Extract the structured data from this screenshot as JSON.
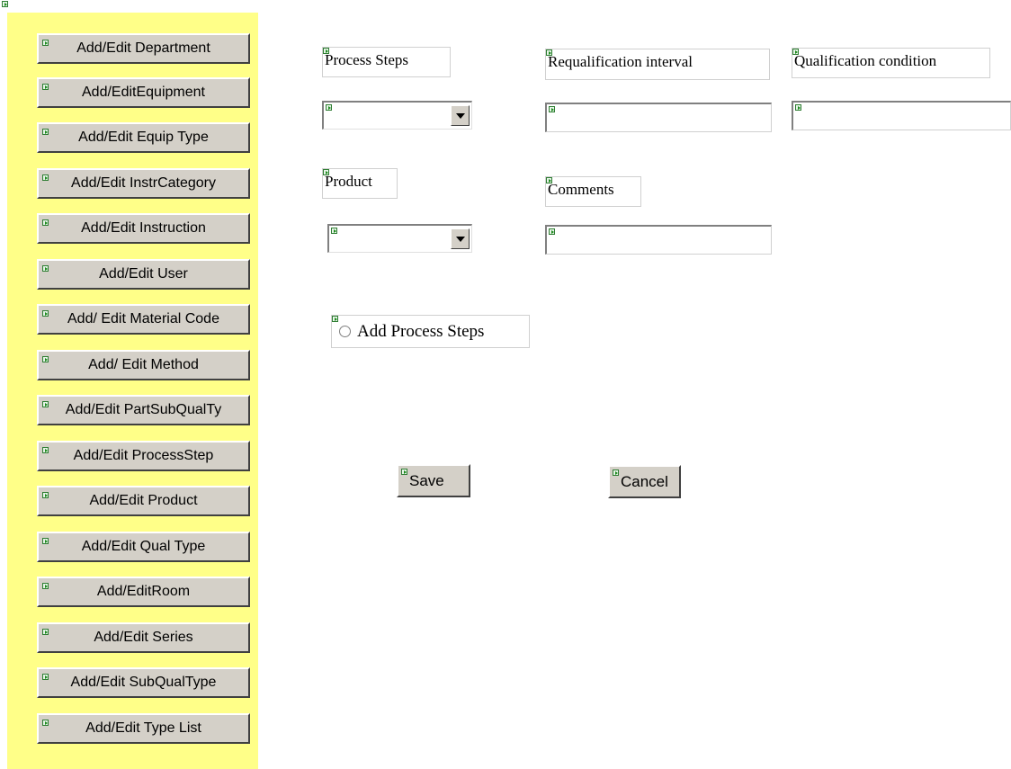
{
  "sidebar": {
    "items": [
      {
        "label": "Add/Edit Department"
      },
      {
        "label": "Add/EditEquipment"
      },
      {
        "label": "Add/Edit Equip Type"
      },
      {
        "label": "Add/Edit InstrCategory"
      },
      {
        "label": "Add/Edit Instruction"
      },
      {
        "label": "Add/Edit User"
      },
      {
        "label": "Add/ Edit Material Code"
      },
      {
        "label": "Add/ Edit Method"
      },
      {
        "label": "Add/Edit PartSubQualTy"
      },
      {
        "label": "Add/Edit ProcessStep"
      },
      {
        "label": "Add/Edit Product"
      },
      {
        "label": "Add/Edit Qual Type"
      },
      {
        "label": "Add/EditRoom"
      },
      {
        "label": "Add/Edit Series"
      },
      {
        "label": "Add/Edit SubQualType"
      },
      {
        "label": "Add/Edit Type List"
      }
    ]
  },
  "form": {
    "process_steps": {
      "label": "Process Steps",
      "value": ""
    },
    "requalification_interval": {
      "label": "Requalification interval",
      "value": ""
    },
    "qualification_condition": {
      "label": "Qualification condition",
      "value": ""
    },
    "product": {
      "label": "Product",
      "value": ""
    },
    "comments": {
      "label": "Comments",
      "value": ""
    },
    "add_process_steps": {
      "label": "Add Process Steps",
      "selected": false
    }
  },
  "actions": {
    "save_label": "Save",
    "cancel_label": "Cancel"
  },
  "icons": {
    "marker": "green-arrow-marker-icon",
    "dropdown": "chevron-down-icon"
  },
  "colors": {
    "sidebar_bg": "#ffff88",
    "button_face": "#d4d0c8",
    "marker": "#1b8a1b"
  }
}
